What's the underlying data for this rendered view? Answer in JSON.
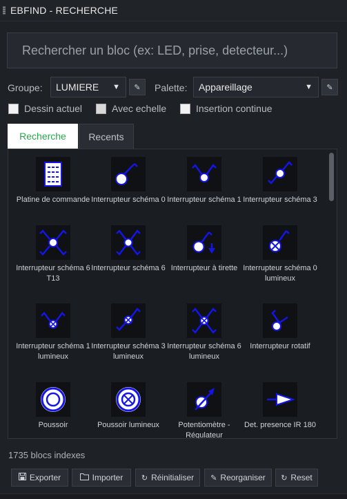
{
  "window": {
    "title": "EBFIND - RECHERCHE"
  },
  "search": {
    "placeholder": "Rechercher un bloc (ex: LED, prise, detecteur...)"
  },
  "filters": {
    "group_label": "Groupe:",
    "group_value": "LUMIERE",
    "palette_label": "Palette:",
    "palette_value": "Appareillage"
  },
  "options": [
    {
      "label": "Dessin actuel",
      "checked": false
    },
    {
      "label": "Avec echelle",
      "checked": false
    },
    {
      "label": "Insertion continue",
      "checked": false
    }
  ],
  "tabs": [
    {
      "label": "Recherche",
      "active": true
    },
    {
      "label": "Recents",
      "active": false
    }
  ],
  "blocks": [
    {
      "name": "Platine de commande",
      "icon": "panel-icon"
    },
    {
      "name": "Interrupteur schéma 0",
      "icon": "switch-0-icon"
    },
    {
      "name": "Interrupteur schéma 1",
      "icon": "switch-1-icon"
    },
    {
      "name": "Interrupteur schéma 3",
      "icon": "switch-3-icon"
    },
    {
      "name": "Interrupteur schéma 6 T13",
      "icon": "switch-6-t13-icon"
    },
    {
      "name": "Interrupteur schéma 6",
      "icon": "switch-6-icon"
    },
    {
      "name": "Interrupteur à tirette",
      "icon": "pull-switch-icon"
    },
    {
      "name": "Interrupteur schéma 0 lumineux",
      "icon": "lit-switch-0-icon"
    },
    {
      "name": "Interrupteur schéma 1 lumineux",
      "icon": "lit-switch-1-icon"
    },
    {
      "name": "Interrupteur schéma 3 lumineux",
      "icon": "lit-switch-3-icon"
    },
    {
      "name": "Interrupteur schéma 6 lumineux",
      "icon": "lit-switch-6-icon"
    },
    {
      "name": "Interrupteur rotatif",
      "icon": "rotary-switch-icon"
    },
    {
      "name": "Poussoir",
      "icon": "pushbutton-icon"
    },
    {
      "name": "Poussoir lumineux",
      "icon": "lit-pushbutton-icon"
    },
    {
      "name": "Potentiomètre - Régulateur",
      "icon": "dimmer-icon"
    },
    {
      "name": "Det. presence IR 180",
      "icon": "ir-detector-icon"
    }
  ],
  "status": {
    "text": "1735 blocs indexes"
  },
  "actions": [
    {
      "label": "Exporter",
      "icon": "save-icon"
    },
    {
      "label": "Importer",
      "icon": "folder-icon"
    },
    {
      "label": "Réinitialiser",
      "icon": "refresh-icon"
    },
    {
      "label": "Reorganiser",
      "icon": "brush-icon"
    },
    {
      "label": "Reset",
      "icon": "refresh-icon"
    }
  ],
  "colors": {
    "accent": "#2ea44f",
    "symbol": "#1515e6",
    "background": "#1e2126"
  }
}
